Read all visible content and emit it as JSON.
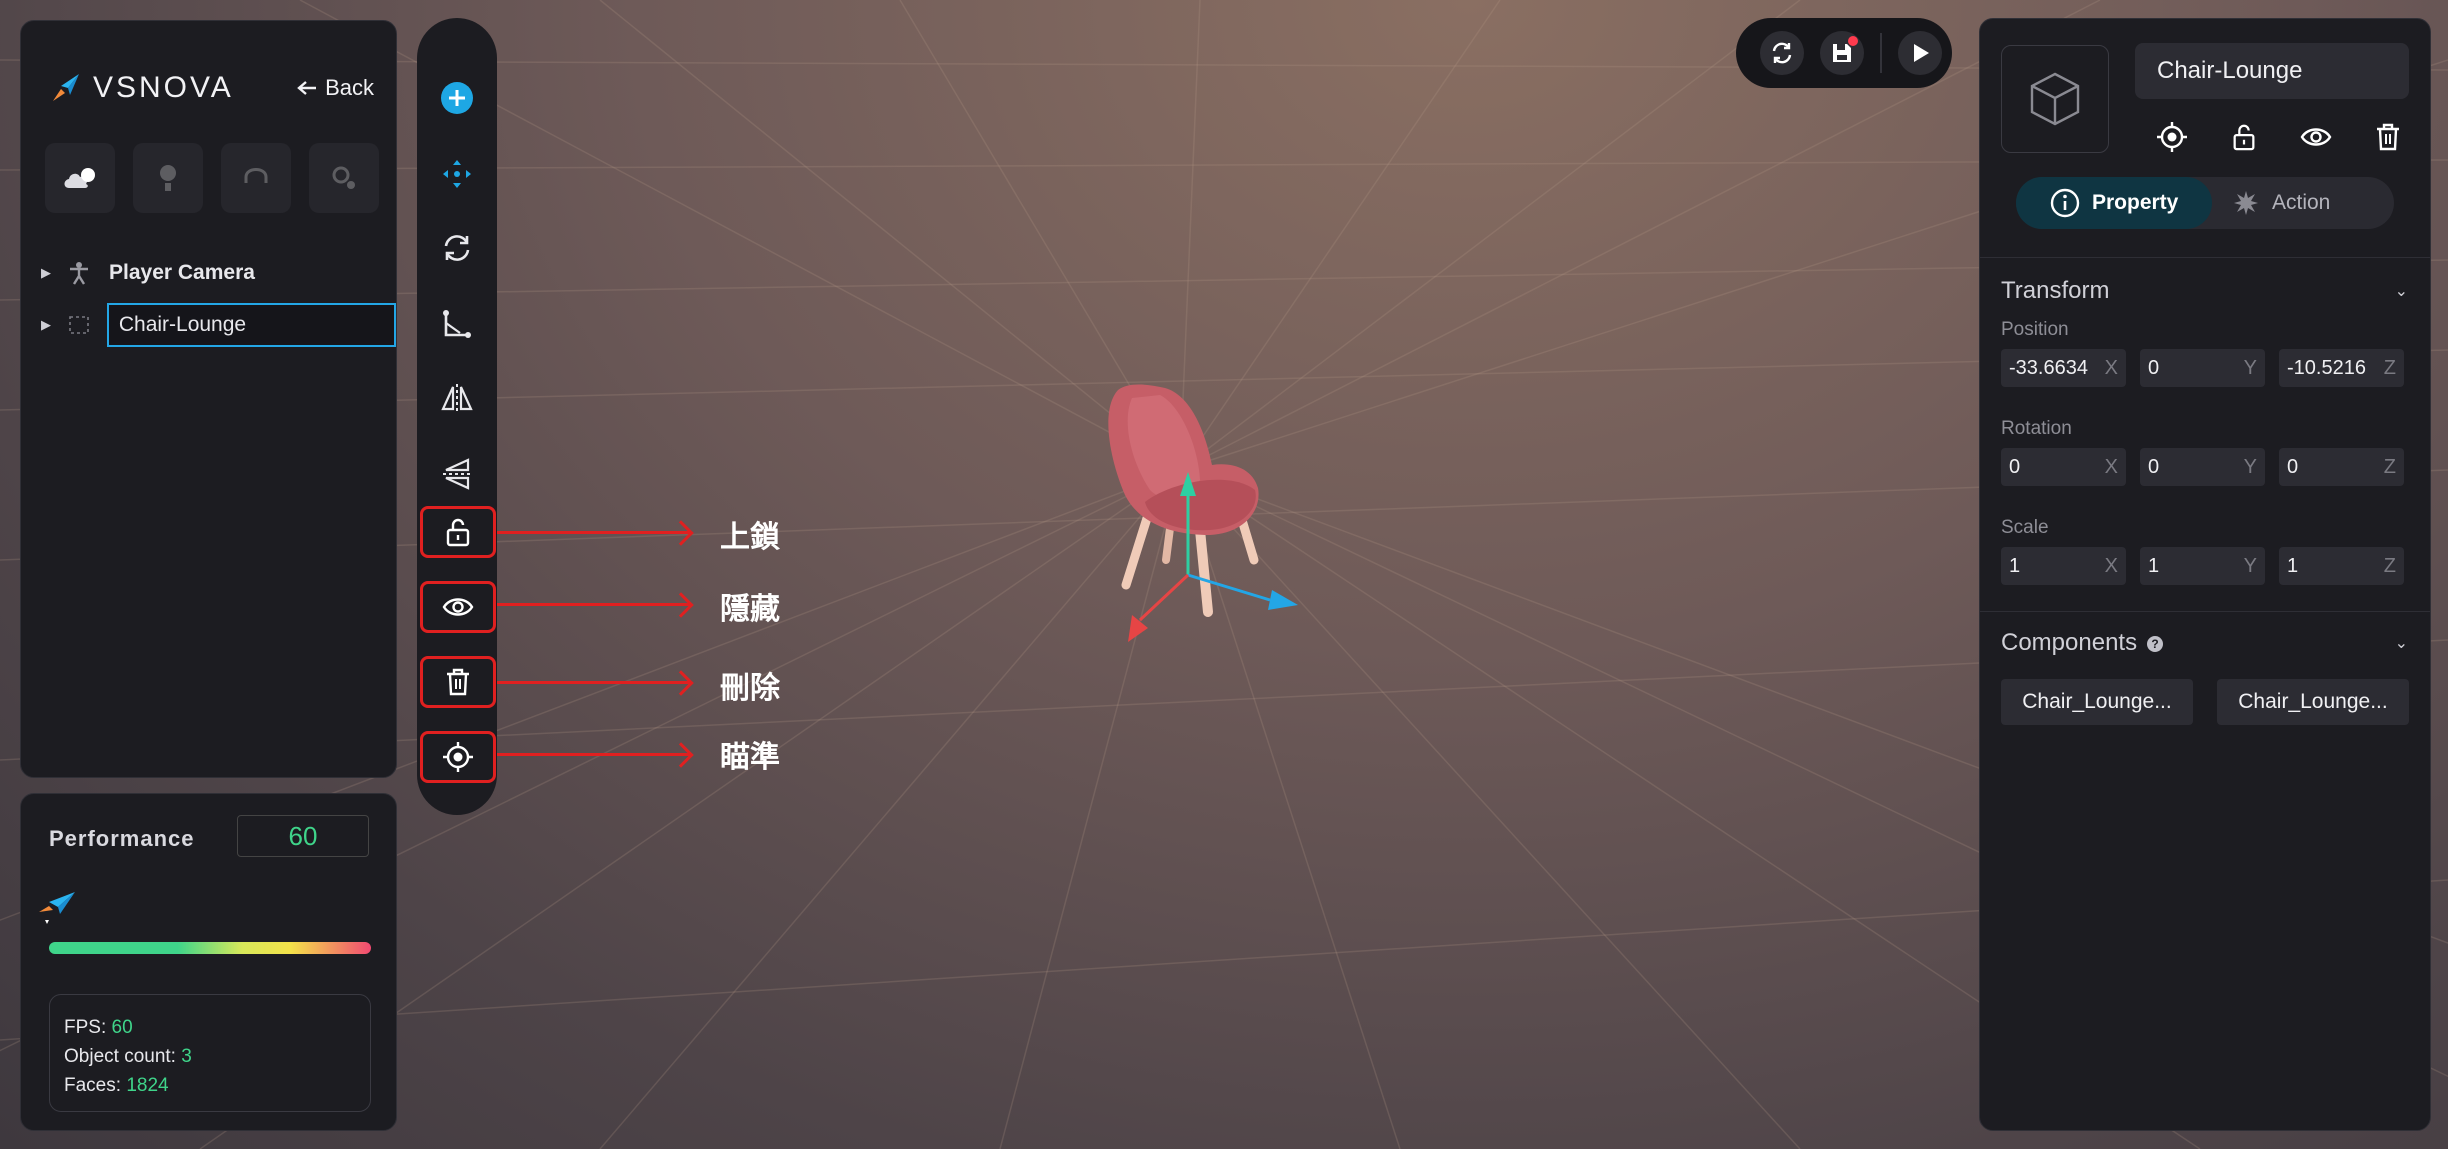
{
  "app": {
    "brand": "VSNOVA",
    "back_label": "Back"
  },
  "outliner": {
    "items": [
      {
        "label": "Player Camera",
        "icon": "person-icon",
        "selected": false
      },
      {
        "label": "Chair-Lounge",
        "icon": "dashed-box-icon",
        "selected": true
      }
    ]
  },
  "performance": {
    "title": "Performance",
    "value": "60",
    "fps_label": "FPS:",
    "fps_value": "60",
    "object_count_label": "Object count:",
    "object_count_value": "3",
    "faces_label": "Faces:",
    "faces_value": "1824"
  },
  "annotations": [
    {
      "label": "上鎖"
    },
    {
      "label": "隱藏"
    },
    {
      "label": "刪除"
    },
    {
      "label": "瞄準"
    }
  ],
  "inspector": {
    "object_name": "Chair-Lounge",
    "tabs": {
      "property": "Property",
      "action": "Action"
    },
    "transform": {
      "title": "Transform",
      "position_label": "Position",
      "position": {
        "x": "-33.6634",
        "y": "0",
        "z": "-10.5216"
      },
      "rotation_label": "Rotation",
      "rotation": {
        "x": "0",
        "y": "0",
        "z": "0"
      },
      "scale_label": "Scale",
      "scale": {
        "x": "1",
        "y": "1",
        "z": "1"
      },
      "axes": {
        "x": "X",
        "y": "Y",
        "z": "Z"
      }
    },
    "components": {
      "title": "Components",
      "help": "?",
      "items": [
        "Chair_Lounge...",
        "Chair_Lounge..."
      ]
    }
  },
  "colors": {
    "accent": "#23a6e6",
    "good": "#3fd48a",
    "annotation": "#e02020"
  }
}
